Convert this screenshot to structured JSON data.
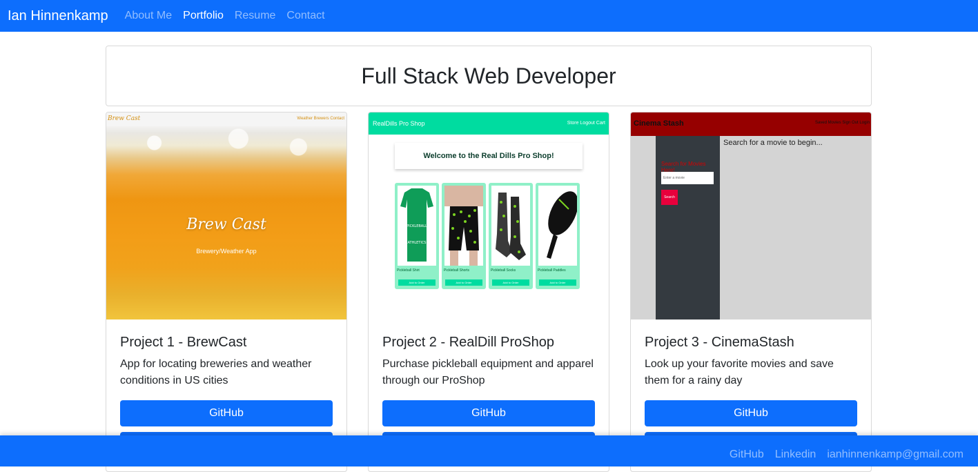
{
  "nav": {
    "brand": "Ian Hinnenkamp",
    "links": [
      "About Me",
      "Portfolio",
      "Resume",
      "Contact"
    ]
  },
  "header": {
    "title": "Full Stack Web Developer"
  },
  "projects": [
    {
      "title": "Project 1 - BrewCast",
      "description": "App for locating breweries and weather conditions in US cities",
      "button": "GitHub",
      "screenshot": {
        "logo": "Brew Cast",
        "links": "Weather  Brewers  Contact",
        "headline": "Brew Cast",
        "subtitle": "Brewery/Weather App"
      }
    },
    {
      "title": "Project 2 - RealDill ProShop",
      "description": "Purchase pickleball equipment and apparel through our ProShop",
      "button": "GitHub",
      "screenshot": {
        "logo": "RealDills Pro Shop",
        "links": "Store  Logout  Cart",
        "welcome": "Welcome to the Real Dills Pro Shop!",
        "items": [
          "Pickleball Shirt",
          "Pickleball Shorts",
          "Pickleball Socks",
          "Pickleball Paddles"
        ],
        "add_label": "Add to Order"
      }
    },
    {
      "title": "Project 3 - CinemaStash",
      "description": "Look up your favorite movies and save them for a rainy day",
      "button": "GitHub",
      "screenshot": {
        "logo": "Cinema Stash",
        "links": "Saved Movies  Sign Out  Login",
        "side_heading": "Search for Movies Here!",
        "input_placeholder": "Enter a movie",
        "search_button": "Search",
        "prompt": "Search for a movie to begin..."
      }
    }
  ],
  "footer": {
    "links": [
      "GitHub",
      "Linkedin",
      "ianhinnenkamp@gmail.com"
    ]
  },
  "colors": {
    "primary": "#0d6efd",
    "dill_green": "#00dca0",
    "cinema_red": "#960000"
  }
}
